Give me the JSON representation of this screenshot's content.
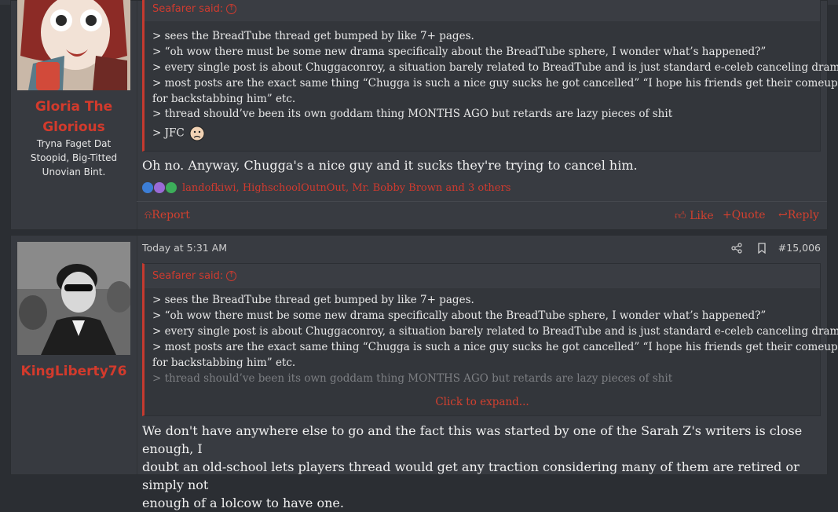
{
  "posts": [
    {
      "author": {
        "name": "Gloria The Glorious",
        "title_lines": [
          "Tryna Faget Dat",
          "Stoopid, Big-Titted",
          "Unovian Bint."
        ]
      },
      "quote": {
        "attribution": "Seafarer said:",
        "lines": [
          "> sees the BreadTube thread get bumped by like 7+ pages.",
          "> “oh wow there must be some new drama specifically about the BreadTube sphere, I wonder what’s happened?”",
          "> every single post is about Chuggaconroy, a situation barely related to BreadTube and is just standard e-celeb canceling drama",
          "> most posts are the exact same thing “Chugga is such a nice guy sucks he got cancelled” “I hope his friends get their comeuppance",
          "for backstabbing him” etc.",
          "> thread should’ve been its own goddam thing MONTHS AGO but retards are lazy pieces of shit",
          "> JFC"
        ]
      },
      "body": "Oh no. Anyway, Chugga's a nice guy and it sucks they're trying to cancel him.",
      "reactions": {
        "names": "landofkiwi, HighschoolOutnOut, Mr. Bobby Brown and 3 others"
      },
      "actions": {
        "report": "Report",
        "like": "Like",
        "quote": "Quote",
        "reply": "Reply"
      }
    },
    {
      "author": {
        "name": "KingLiberty76"
      },
      "timestamp": "Today at 5:31 AM",
      "post_number": "#15,006",
      "quote": {
        "attribution": "Seafarer said:",
        "lines": [
          "> sees the BreadTube thread get bumped by like 7+ pages.",
          "> “oh wow there must be some new drama specifically about the BreadTube sphere, I wonder what’s happened?”",
          "> every single post is about Chuggaconroy, a situation barely related to BreadTube and is just standard e-celeb canceling drama",
          "> most posts are the exact same thing “Chugga is such a nice guy sucks he got cancelled” “I hope his friends get their comeuppance",
          "for backstabbing him” etc.",
          "> thread should’ve been its own goddam thing MONTHS AGO but retards are lazy pieces of shit"
        ],
        "expand_label": "Click to expand..."
      },
      "body_lines": [
        "We don't have anywhere else to go and the fact this was started by one of the Sarah Z's writers is close enough, I",
        "doubt an old-school lets players thread would get any traction considering many of them are retired or simply not",
        "enough of a lolcow to have one."
      ]
    }
  ],
  "colors": {
    "accent": "#d2402f",
    "background": "#2b2e33",
    "panel": "#383b41"
  }
}
